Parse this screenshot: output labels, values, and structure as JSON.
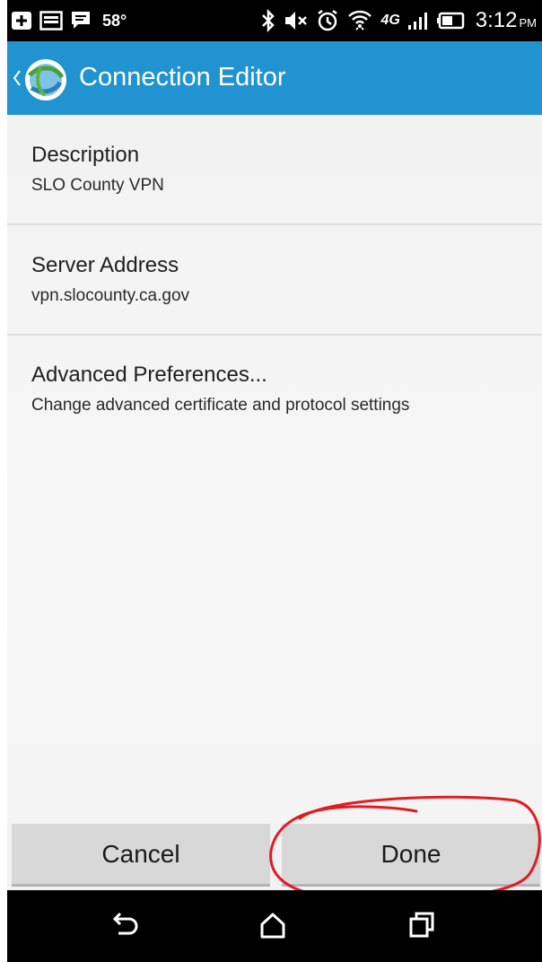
{
  "status_bar": {
    "temperature": "58°",
    "network": "4G",
    "time": "3:12",
    "ampm": "PM",
    "icons": [
      "plus-box-icon",
      "photo-icon",
      "message-icon",
      "bluetooth-icon",
      "mute-icon",
      "alarm-icon",
      "wifi-icon",
      "signal-icon",
      "battery-icon"
    ]
  },
  "action_bar": {
    "title": "Connection Editor",
    "accent_color": "#2193d0"
  },
  "preferences": [
    {
      "title": "Description",
      "summary": "SLO County VPN"
    },
    {
      "title": "Server Address",
      "summary": "vpn.slocounty.ca.gov"
    },
    {
      "title": "Advanced Preferences...",
      "summary": "Change advanced certificate and protocol settings"
    }
  ],
  "buttons": {
    "cancel_label": "Cancel",
    "done_label": "Done"
  },
  "annotation": {
    "shape": "hand-drawn ellipse around Done button",
    "color": "#e21b22"
  },
  "nav_bar": {
    "icons": [
      "back-icon",
      "home-icon",
      "recent-apps-icon"
    ]
  }
}
